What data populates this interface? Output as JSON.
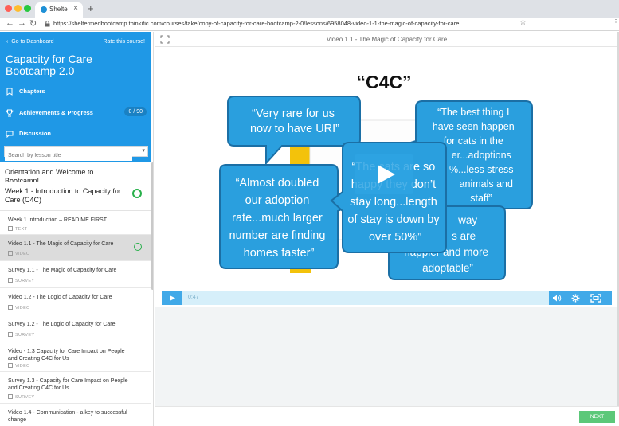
{
  "browser": {
    "tab_title": "Shelte",
    "url": "https://sheltermedbootcamp.thinkific.com/courses/take/copy-of-capacity-for-care-bootcamp-2-0/lessons/6958048-video-1-1-the-magic-of-capacity-for-care"
  },
  "sidebar": {
    "back_label": "Go to Dashboard",
    "rate_label": "Rate this course!",
    "course_title": "Capacity for Care Bootcamp 2.0",
    "nav": [
      {
        "label": "Chapters",
        "icon": "bookmark-icon"
      },
      {
        "label": "Achievements & Progress",
        "icon": "trophy-icon",
        "count": "0 / 90"
      },
      {
        "label": "Discussion",
        "icon": "chat-icon"
      }
    ],
    "search_placeholder": "Search by lesson title",
    "chapters": [
      {
        "title": "Orientation and Welcome to Bootcamp!"
      },
      {
        "title": "Week 1 - Introduction to Capacity for Care (C4C)"
      }
    ],
    "lessons": [
      {
        "title": "Week 1 Introduction – READ ME FIRST",
        "type": "TEXT"
      },
      {
        "title": "Video 1.1 - The Magic of Capacity for Care",
        "type": "VIDEO"
      },
      {
        "title": "Survey 1.1 - The Magic of Capacity for Care",
        "type": "SURVEY"
      },
      {
        "title": "Video 1.2 - The Logic of Capacity for Care",
        "type": "VIDEO"
      },
      {
        "title": "Survey 1.2 - The Logic of Capacity for Care",
        "type": "SURVEY"
      },
      {
        "title": "Video - 1.3 Capacity for Care Impact on People and Creating C4C for Us",
        "type": "VIDEO"
      },
      {
        "title": "Survey 1.3 - Capacity for Care Impact on People and Creating C4C for Us",
        "type": "SURVEY"
      },
      {
        "title": "Video 1.4 - Communication - a key to successful change",
        "type": ""
      }
    ]
  },
  "main": {
    "lesson_heading": "Video 1.1 - The Magic of Capacity for Care",
    "slide": {
      "title": "“C4C”",
      "bubbles": [
        "“Very rare for us now to have URI”",
        "“The best thing I have seen happen for cats in the er...adoptions %...less stress animals and staff”",
        "“Almost doubled our adoption rate...much larger number are finding homes faster”",
        "“The cats are so happy they don’t stay long...length of stay is down by over 50%”",
        "way s are happier and more adoptable”"
      ]
    },
    "timecode": "0:47",
    "next_label": "NEXT"
  },
  "colors": {
    "brand_blue": "#1f98e6",
    "bubble_blue": "#2a9fde",
    "progress_green": "#28b04b",
    "next_green": "#5cc879"
  }
}
